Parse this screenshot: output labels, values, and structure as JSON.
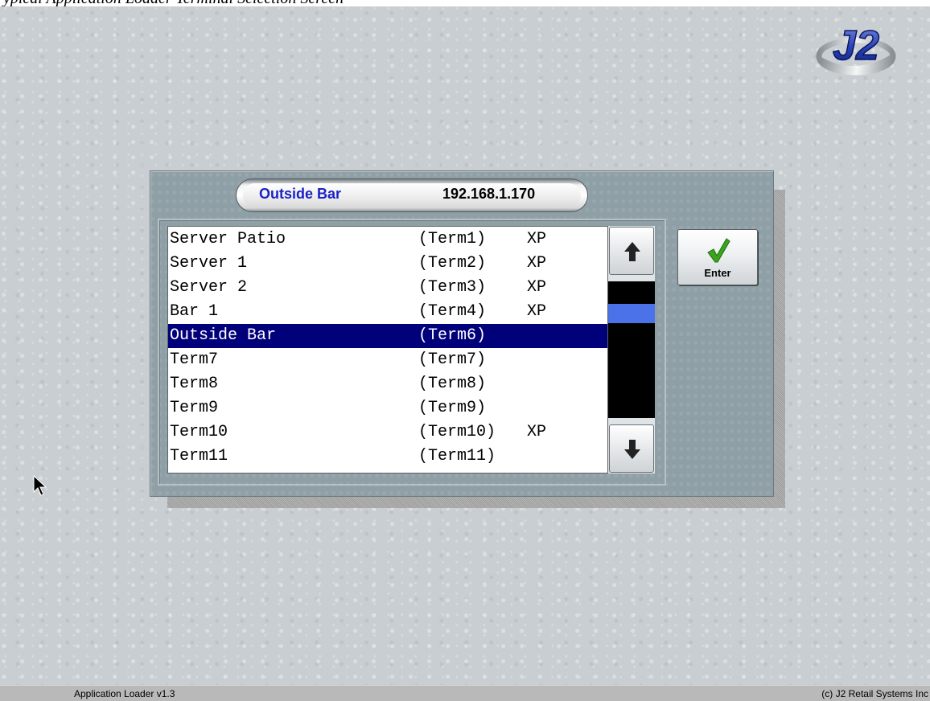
{
  "top_caption": "ypical Application Loader Terminal Selection Screen",
  "header": {
    "terminal_name": "Outside Bar",
    "ip_address": "192.168.1.170"
  },
  "terminals": [
    {
      "name": "Server Patio",
      "term": "(Term1)",
      "os": "XP"
    },
    {
      "name": "Server 1",
      "term": "(Term2)",
      "os": "XP"
    },
    {
      "name": "Server 2",
      "term": "(Term3)",
      "os": "XP"
    },
    {
      "name": "Bar 1",
      "term": "(Term4)",
      "os": "XP"
    },
    {
      "name": "Outside Bar",
      "term": "(Term6)",
      "os": ""
    },
    {
      "name": "Term7",
      "term": "(Term7)",
      "os": ""
    },
    {
      "name": "Term8",
      "term": "(Term8)",
      "os": ""
    },
    {
      "name": "Term9",
      "term": "(Term9)",
      "os": ""
    },
    {
      "name": "Term10",
      "term": "(Term10)",
      "os": "XP"
    },
    {
      "name": "Term11",
      "term": "(Term11)",
      "os": ""
    }
  ],
  "selected_index": 4,
  "buttons": {
    "enter_label": "Enter",
    "scroll_up_icon": "arrow-up-icon",
    "scroll_down_icon": "arrow-down-icon"
  },
  "status_bar": {
    "left": "Application Loader  v1.3",
    "right": "(c) J2 Retail Systems Inc"
  },
  "logo_text": "J2",
  "colors": {
    "selection_bg": "#00007b",
    "header_name": "#1a22c8",
    "scroll_thumb": "#4b72e8",
    "check": "#3aa51c"
  }
}
